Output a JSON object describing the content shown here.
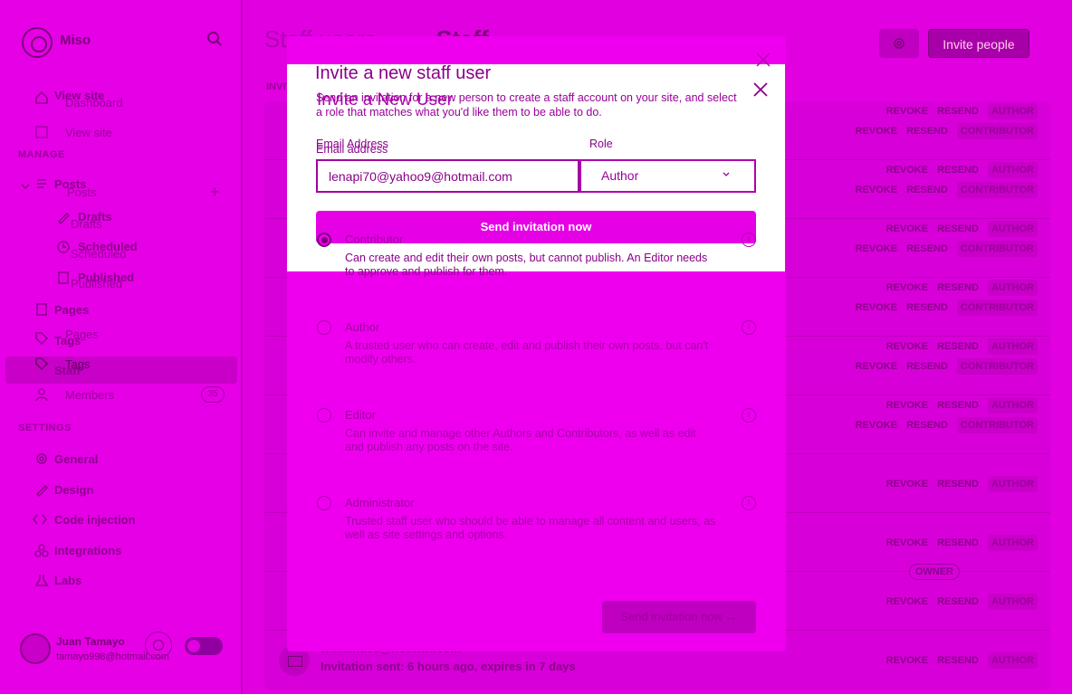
{
  "sidebar": {
    "site_title": "Miso",
    "items_top": [
      {
        "label": "View site"
      },
      {
        "label": "Dashboard"
      }
    ],
    "ghost_top": "View site",
    "section_manage": "MANAGE",
    "posts": "Posts",
    "posts_ghost": "Posts",
    "sub": [
      {
        "label": "Drafts",
        "ghost": "Drafts"
      },
      {
        "label": "Scheduled",
        "ghost": "Scheduled"
      },
      {
        "label": "Published",
        "ghost": "Published"
      }
    ],
    "pages": "Pages",
    "pages_ghost": "Pages",
    "tags": "Tags",
    "tags_active": "Tags",
    "staff": "Staff",
    "members": "Members",
    "members_count": "35",
    "section_settings": "SETTINGS",
    "settings_items": [
      {
        "label": "General"
      },
      {
        "label": "Design"
      },
      {
        "label": "Code injection"
      },
      {
        "label": "Integrations"
      },
      {
        "label": "Labs"
      }
    ],
    "user_name": "Juan Tamayo",
    "user_email": "tamayo998@hotmail.com"
  },
  "main": {
    "title": "Staff",
    "title_ghost": "Staff users",
    "invite_label": "Invite people",
    "section_label": "INVITED USERS",
    "rows": [
      {
        "actions": [
          "REVOKE",
          "RESEND"
        ],
        "role": "AUTHOR",
        "actions2": [
          "REVOKE",
          "RESEND"
        ],
        "role2": "CONTRIBUTOR"
      },
      {
        "actions": [
          "REVOKE",
          "RESEND"
        ],
        "role": "AUTHOR",
        "actions2": [
          "REVOKE",
          "RESEND"
        ],
        "role2": "CONTRIBUTOR"
      },
      {
        "actions": [
          "REVOKE",
          "RESEND"
        ],
        "role": "AUTHOR",
        "actions2": [
          "REVOKE",
          "RESEND"
        ],
        "role2": "CONTRIBUTOR"
      },
      {
        "actions": [
          "REVOKE",
          "RESEND"
        ],
        "role": "AUTHOR",
        "actions2": [
          "REVOKE",
          "RESEND"
        ],
        "role2": "CONTRIBUTOR"
      },
      {
        "actions": [
          "REVOKE",
          "RESEND"
        ],
        "role": "AUTHOR",
        "actions2": [
          "REVOKE",
          "RESEND"
        ],
        "role2": "CONTRIBUTOR"
      },
      {
        "actions": [
          "REVOKE",
          "RESEND"
        ],
        "role": "AUTHOR",
        "actions2": [
          "REVOKE",
          "RESEND"
        ],
        "role2": "CONTRIBUTOR"
      },
      {
        "actions": [
          "REVOKE",
          "RESEND"
        ],
        "role": "AUTHOR"
      },
      {
        "actions": [
          "REVOKE",
          "RESEND"
        ],
        "role": "AUTHOR"
      },
      {
        "actions": [
          "REVOKE",
          "RESEND"
        ],
        "role": "AUTHOR"
      },
      {
        "actions": [
          "REVOKE",
          "RESEND"
        ],
        "role": "AUTHOR",
        "email": "williamd93@hotmail.com",
        "sent": "Invitation sent: 6 hours ago, expires in 7 days"
      }
    ],
    "owner_label": "OWNER"
  },
  "modal": {
    "title": "Invite a new staff user",
    "ghost_title": "Invite a New User",
    "subtitle": "Send an invitation for a new person to create a staff account on your site, and select a role that matches what you'd like them to be able to do.",
    "email_label": "Email address",
    "email_label_ghost": "Email Address",
    "email_value": "lenapi70@yahoo9@hotmail.com",
    "role_label": "Role",
    "role_value": "Author",
    "send_label": "Send invitation now",
    "roles": [
      {
        "name": "Contributor",
        "desc": "Can create and edit their own posts, but cannot publish. An Editor needs to approve and publish for them."
      },
      {
        "name": "Author",
        "desc": "A trusted user who can create, edit and publish their own posts, but can't modify others."
      },
      {
        "name": "Editor",
        "desc": "Can invite and manage other Authors and Contributors, as well as edit and publish any posts on the site."
      },
      {
        "name": "Administrator",
        "desc": "Trusted staff user who should be able to manage all content and users, as well as site settings and options."
      }
    ],
    "send_bottom": "Send invitation now →"
  },
  "colors": {
    "background": "#e000e0",
    "accent": "#a800a8",
    "modal": "#ffffff"
  }
}
